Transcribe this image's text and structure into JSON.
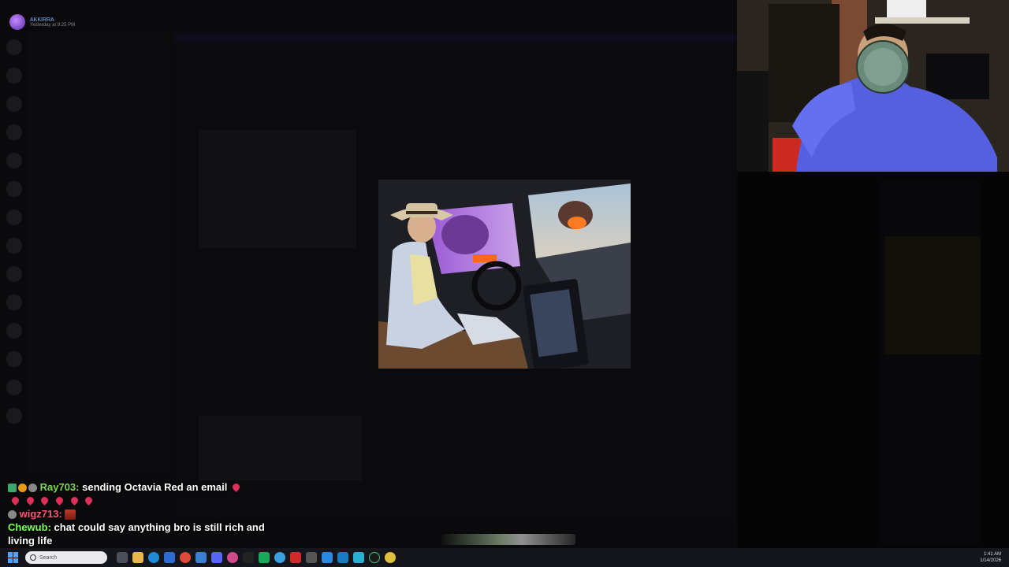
{
  "discord": {
    "user": {
      "name": "AKKIRRA",
      "timestamp": "Yesterday at 9:25 PM"
    }
  },
  "chat": [
    {
      "user": "Ray703",
      "text": "sending Octavia Red an email"
    },
    {
      "user": "wigz713",
      "text": ""
    },
    {
      "user": "Chewub",
      "text": "chat could say anything bro is still rich and living life"
    }
  ],
  "taskbar": {
    "search_placeholder": "Search",
    "time": "1:41 AM",
    "date": "1/14/2026"
  },
  "colors": {
    "ray703": "#7ed957",
    "wigz713": "#ff5577",
    "chewub": "#7cff5a"
  }
}
